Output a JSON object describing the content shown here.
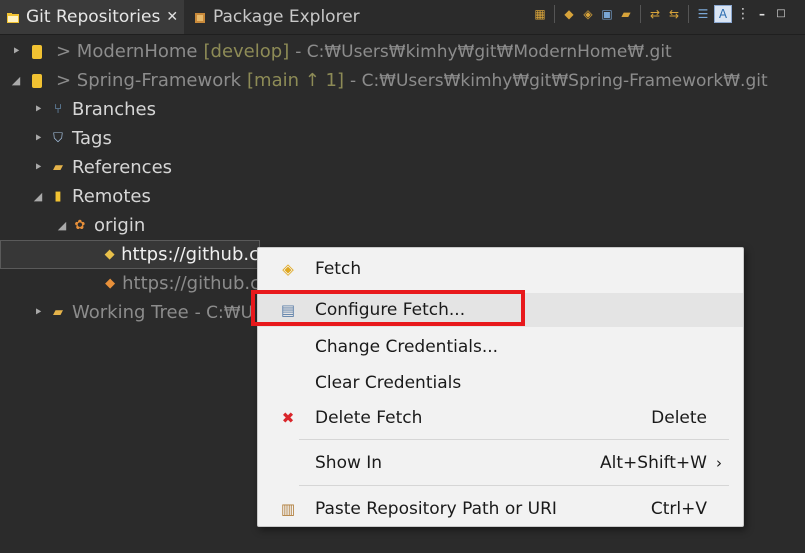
{
  "tabs": [
    {
      "label": "Git Repositories",
      "active": true
    },
    {
      "label": "Package Explorer",
      "active": false
    }
  ],
  "toolbar": {
    "icons": [
      "collapse-all-icon",
      "link-with-editor-icon",
      "add-repository-icon",
      "clone-repository-icon",
      "create-repository-icon",
      "pull-icon",
      "push-icon",
      "hierarchical-view-icon",
      "filter-icon",
      "view-menu-icon",
      "minimize-icon"
    ]
  },
  "tree": {
    "repo1": {
      "name": "> ModernHome",
      "branch": "[develop]",
      "path": "- C:₩Users₩kimhy₩git₩ModernHome₩.git"
    },
    "repo2": {
      "name": "> Spring-Framework",
      "branch": "[main ↑ 1]",
      "path": "- C:₩Users₩kimhy₩git₩Spring-Framework₩.git"
    },
    "branches": "Branches",
    "tags": "Tags",
    "references": "References",
    "remotes": "Remotes",
    "origin": "origin",
    "fetch_url": "https://github.c",
    "push_url": "https://github.c",
    "working_tree": "Working Tree",
    "working_tree_path": "- C:₩U"
  },
  "context_menu": {
    "fetch": "Fetch",
    "configure_fetch": "Configure Fetch...",
    "change_credentials": "Change Credentials...",
    "clear_credentials": "Clear Credentials",
    "delete_fetch": "Delete Fetch",
    "delete_key": "Delete",
    "show_in": "Show In",
    "show_in_key": "Alt+Shift+W",
    "paste_path": "Paste Repository Path or URI",
    "paste_key": "Ctrl+V"
  },
  "colors": {
    "highlight": "#e8191c",
    "branch_text": "#8d8b56",
    "accent_yellow": "#f1c232"
  }
}
